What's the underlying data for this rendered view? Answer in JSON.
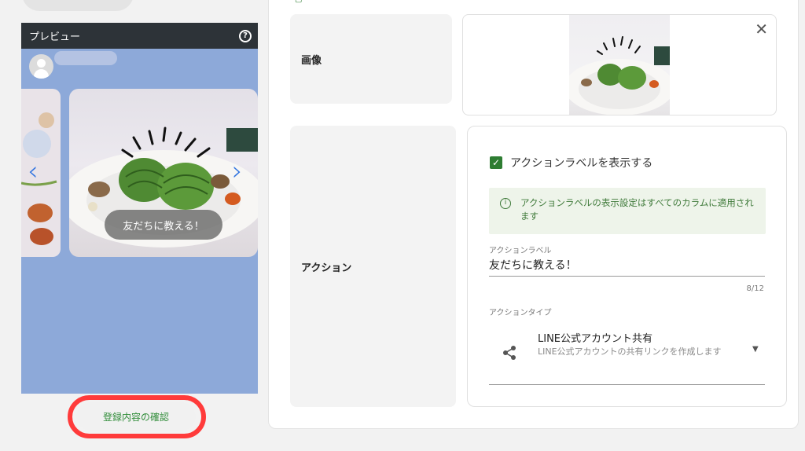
{
  "preview": {
    "title": "プレビュー",
    "help_icon": "help-circle-icon",
    "card_label": "友だちに教える！"
  },
  "confirm_button": "登録内容の確認",
  "image_section": {
    "label": "画像",
    "close_icon": "close-icon"
  },
  "action_section": {
    "label": "アクション",
    "show_label_checkbox": "アクションラベルを表示する",
    "info_text": "アクションラベルの表示設定はすべてのカラムに適用されます",
    "action_label_caption": "アクションラベル",
    "action_label_value": "友だちに教える！",
    "action_label_counter": "8/12",
    "action_type_caption": "アクションタイプ",
    "action_type_title": "LINE公式アカウント共有",
    "action_type_desc": "LINE公式アカウントの共有リンクを作成します"
  },
  "colors": {
    "accent_green": "#2e7d32",
    "highlight_red": "#ff3b3b",
    "preview_bg": "#8da9d9"
  }
}
